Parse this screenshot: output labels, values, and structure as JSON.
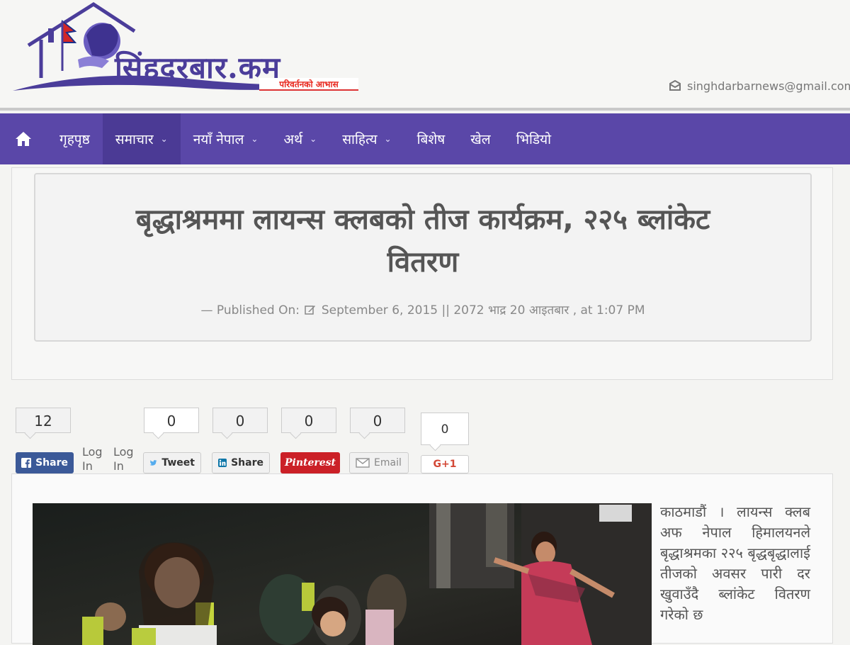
{
  "site": {
    "logo_text": "सिंहदरबार.कम",
    "tagline": "परिवर्तनको आभास",
    "email": "singhdarbarnews@gmail.com"
  },
  "nav": {
    "items": [
      {
        "label": "गृहपृष्ठ",
        "dropdown": false
      },
      {
        "label": "समाचार",
        "dropdown": true
      },
      {
        "label": "नयाँ नेपाल",
        "dropdown": true
      },
      {
        "label": "अर्थ",
        "dropdown": true
      },
      {
        "label": "साहित्य",
        "dropdown": true
      },
      {
        "label": "बिशेष",
        "dropdown": false
      },
      {
        "label": "खेल",
        "dropdown": false
      },
      {
        "label": "भिडियो",
        "dropdown": false
      }
    ],
    "active_index": 1,
    "background": "#5a47a8"
  },
  "article": {
    "title_line1": "बृद्धाश्रममा लायन्स क्लबको तीज कार्यक्रम, २२५ ब्लांकेट",
    "title_line2": "वितरण",
    "published_prefix": "— Published On:",
    "published_date": "September 6, 2015 || 2072 भाद्र 20 आइतबार , at 1:07 PM",
    "body": "काठमाडौं । लायन्स क्लब अफ नेपाल हिमालयनले बृद्धाश्रमका २२५ बृद्धबृद्धालाई तीजको अवसर पारी दर खुवाउँदै ब्लांकेट वितरण गरेको छ"
  },
  "share": {
    "facebook": {
      "count": "12",
      "label": "Share"
    },
    "login_1": "Log In",
    "login_2": "Log In",
    "twitter": {
      "count": "0",
      "label": "Tweet"
    },
    "linkedin": {
      "count": "0",
      "label": "Share"
    },
    "pinterest": {
      "count": "0",
      "label": "Pinterest"
    },
    "email": {
      "count": "0",
      "label": "Email"
    },
    "gplus": {
      "count": "0",
      "label": "G+1"
    }
  }
}
